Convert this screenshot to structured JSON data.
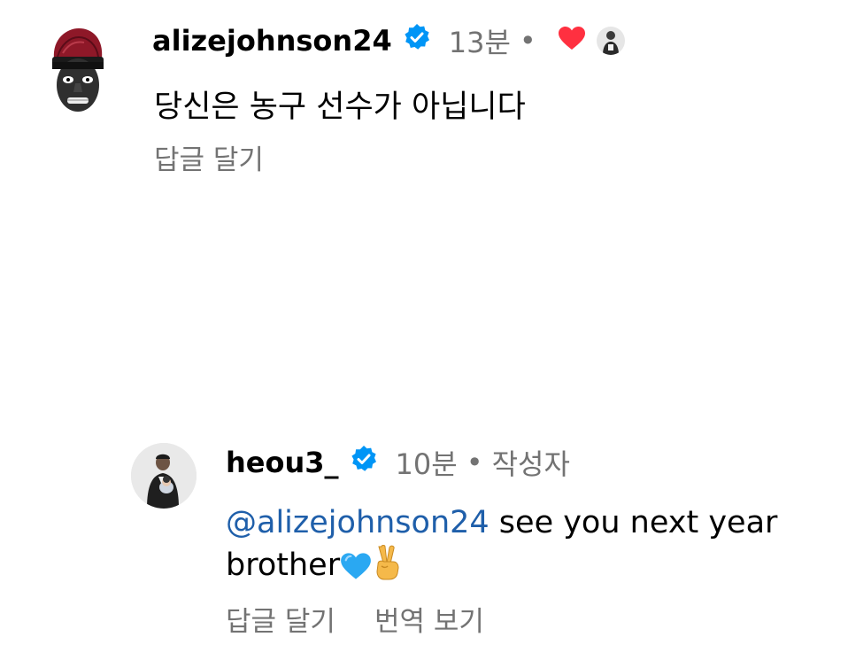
{
  "comments": [
    {
      "username": "alizejohnson24",
      "time": "13분",
      "text": "당신은 농구 선수가 아닙니다",
      "reply_label": "답글 달기",
      "liked_by_author": true
    },
    {
      "username": "heou3_",
      "time": "10분",
      "author_label": "작성자",
      "mention": "@alizejohnson24",
      "text_line1": " see you next year",
      "text_line2": "brother",
      "reply_label": "답글 달기",
      "translate_label": "번역 보기"
    }
  ],
  "separator": "•",
  "colors": {
    "meta": "#737373",
    "mention": "#1f5faa",
    "verified": "#0095f6",
    "heart": "#ff3040"
  },
  "icons": [
    "verified-badge-icon",
    "heart-icon",
    "blue-heart-emoji",
    "victory-hand-emoji"
  ]
}
